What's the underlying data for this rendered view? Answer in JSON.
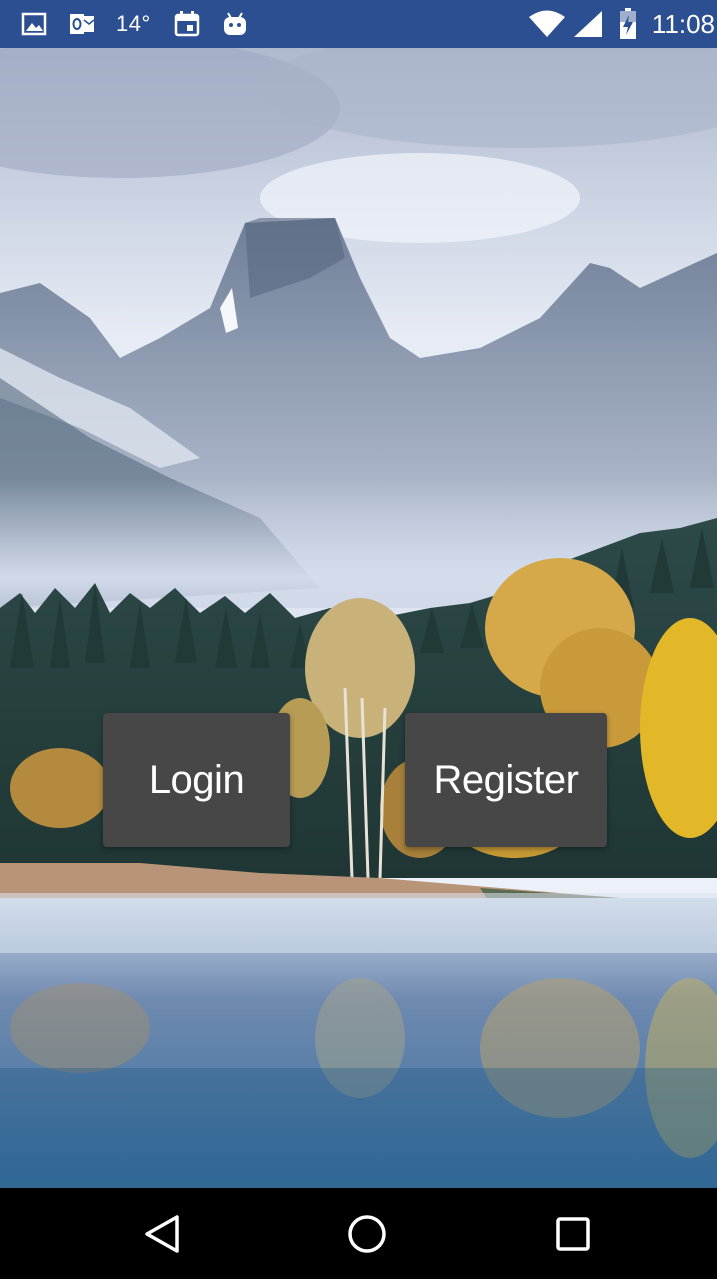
{
  "status_bar": {
    "temperature": "14°",
    "time": "11:08",
    "icons": [
      "gallery-icon",
      "outlook-icon",
      "calendar-icon",
      "android-icon",
      "wifi-icon",
      "signal-icon",
      "battery-charging-icon"
    ],
    "background_color": "#2b4f91"
  },
  "main": {
    "background": "mountain-lake-forest-photo",
    "login_label": "Login",
    "register_label": "Register",
    "button_color": "#474747"
  },
  "nav_bar": {
    "icons": [
      "back-icon",
      "home-icon",
      "recents-icon"
    ]
  }
}
